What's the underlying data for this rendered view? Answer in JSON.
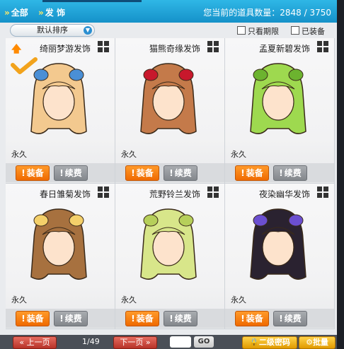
{
  "titlebar": {
    "crumb_all": "全部",
    "crumb_category": "发 饰",
    "count_label": "您当前的道具数量：",
    "count_current": "2848",
    "count_separator": "/",
    "count_max": "3750"
  },
  "filters": {
    "sort_label": "默认排序",
    "only_limited_label": "只看期限",
    "equipped_label": "已装备"
  },
  "items": [
    {
      "name": "绮丽梦游发饰",
      "duration": "永久",
      "equip_label": "装备",
      "renew_label": "续费",
      "hair_color": "#f3c98f",
      "accent": "#4a8fd6",
      "selected": true
    },
    {
      "name": "猫熊奇缘发饰",
      "duration": "永久",
      "equip_label": "装备",
      "renew_label": "续费",
      "hair_color": "#c47a4a",
      "accent": "#c8182c",
      "selected": false
    },
    {
      "name": "孟夏新碧发饰",
      "duration": "永久",
      "equip_label": "装备",
      "renew_label": "续费",
      "hair_color": "#9ed94f",
      "accent": "#6cb32f",
      "selected": false
    },
    {
      "name": "春日雏菊发饰",
      "duration": "永久",
      "equip_label": "装备",
      "renew_label": "续费",
      "hair_color": "#a7713f",
      "accent": "#f4d06a",
      "selected": false
    },
    {
      "name": "荒野铃兰发饰",
      "duration": "永久",
      "equip_label": "装备",
      "renew_label": "续费",
      "hair_color": "#d8e68a",
      "accent": "#b6cf5a",
      "selected": false
    },
    {
      "name": "夜染幽华发饰",
      "duration": "永久",
      "equip_label": "装备",
      "renew_label": "续费",
      "hair_color": "#2a2230",
      "accent": "#6b4fd0",
      "selected": false
    }
  ],
  "pager": {
    "prev_label": "上一页",
    "page_display": "1/49",
    "next_label": "下一页",
    "go_label": "GO",
    "password_label": "二级密码",
    "batch_label": "批量"
  },
  "colors": {
    "titlebar": "#1fa3d8",
    "equip_button": "#f57c00",
    "renew_button": "#8c9095",
    "page_button": "#c9443a"
  }
}
